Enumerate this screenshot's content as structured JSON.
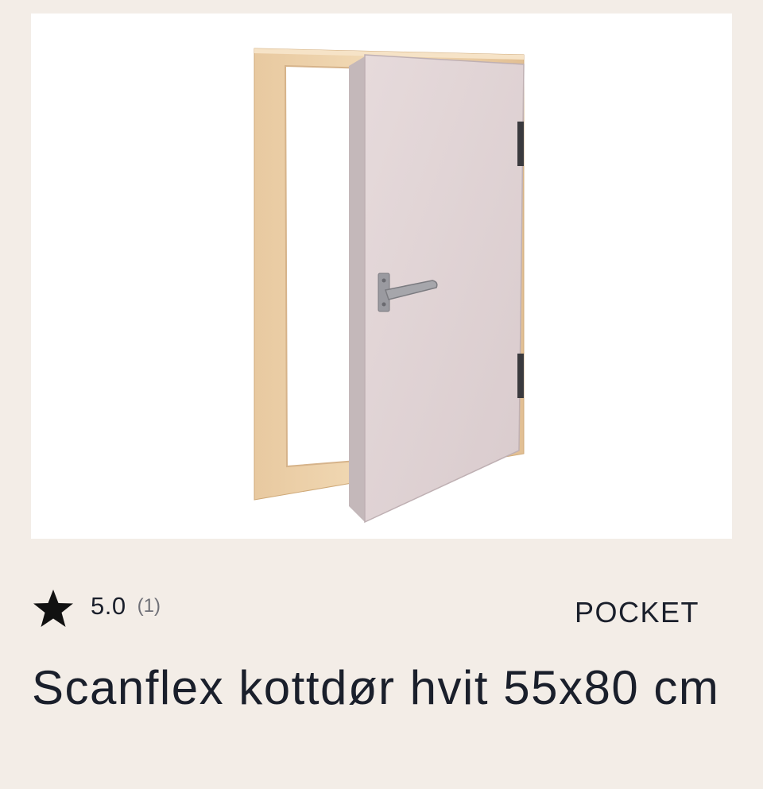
{
  "product": {
    "image_alt": "Scanflex kottdør hvit 55x80 cm",
    "rating_value": "5.0",
    "rating_count": "(1)",
    "brand": "POCKET",
    "title": "Scanflex kottdør hvit 55x80 cm"
  },
  "icons": {
    "rating": "star-icon"
  },
  "colors": {
    "page_background": "#f3ede7",
    "image_background": "#ffffff",
    "text": "#1a1f2b",
    "muted_text": "#6f7077",
    "star": "#111111"
  }
}
